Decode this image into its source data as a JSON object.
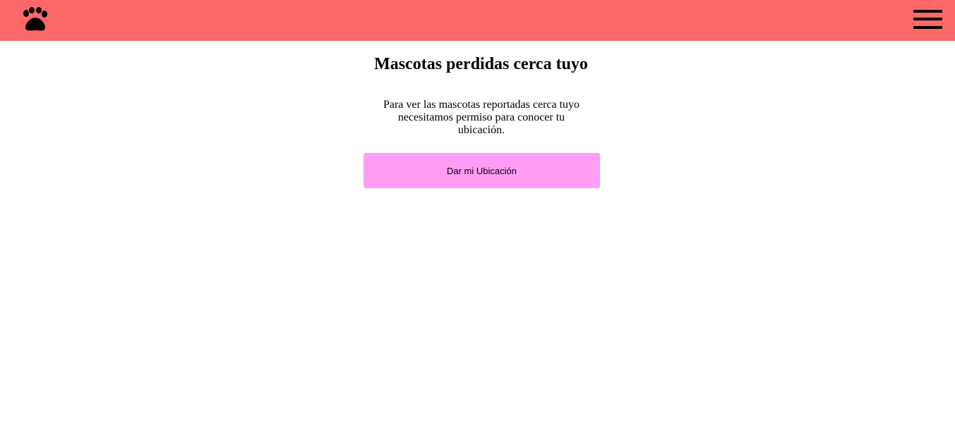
{
  "header": {
    "logo_icon": "paw-icon",
    "menu_icon": "hamburger-menu-icon",
    "background_color": "#ff6868"
  },
  "main": {
    "title": "Mascotas perdidas cerca tuyo",
    "message": "Para ver las mascotas reportadas cerca tuyo necesitamos permiso para conocer tu ubicación.",
    "location_button_label": "Dar mi Ubicación",
    "button_color": "#ff9ef4"
  }
}
